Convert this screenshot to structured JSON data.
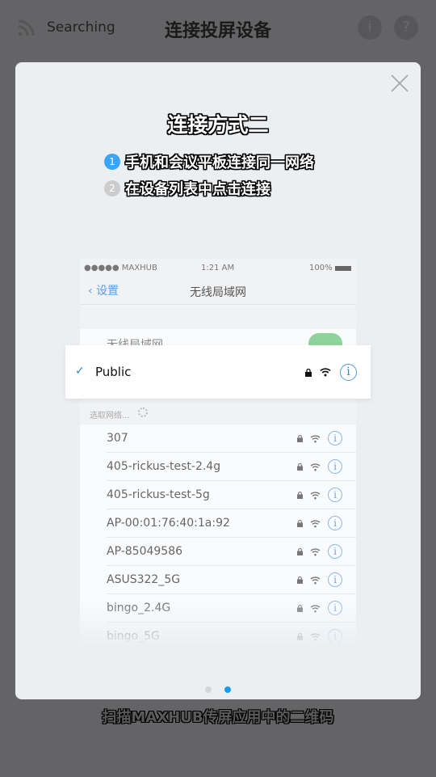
{
  "header": {
    "status": "Searching",
    "title": "连接投屏设备",
    "info_icon": "i",
    "help_icon": "?"
  },
  "modal": {
    "title": "连接方式二",
    "steps": [
      {
        "num": "1",
        "text": "手机和会议平板连接同一网络",
        "color": "#3ba5f5"
      },
      {
        "num": "2",
        "text": "在设备列表中点击连接",
        "color": "#cccccc"
      }
    ],
    "phone": {
      "carrier": "●●●●● MAXHUB",
      "time": "1:21 AM",
      "battery": "100%",
      "back_label": "设置",
      "nav_title": "无线局域网",
      "wifi_toggle_label": "无线局域网",
      "wifi_on": true,
      "connected": {
        "name": "Public",
        "check": "✓",
        "info": "i"
      },
      "choose_label": "选取网络...",
      "networks": [
        "307",
        "405-rickus-test-2.4g",
        "405-rickus-test-5g",
        "AP-00:01:76:40:1a:92",
        "AP-85049586",
        "ASUS322_5G",
        "bingo_2.4G",
        "bingo_5G"
      ]
    },
    "page_indicator": {
      "total": 2,
      "active": 2,
      "active_color": "#1a9bf0"
    }
  },
  "caption": "扫描MAXHUB传屏应用中的二维码"
}
